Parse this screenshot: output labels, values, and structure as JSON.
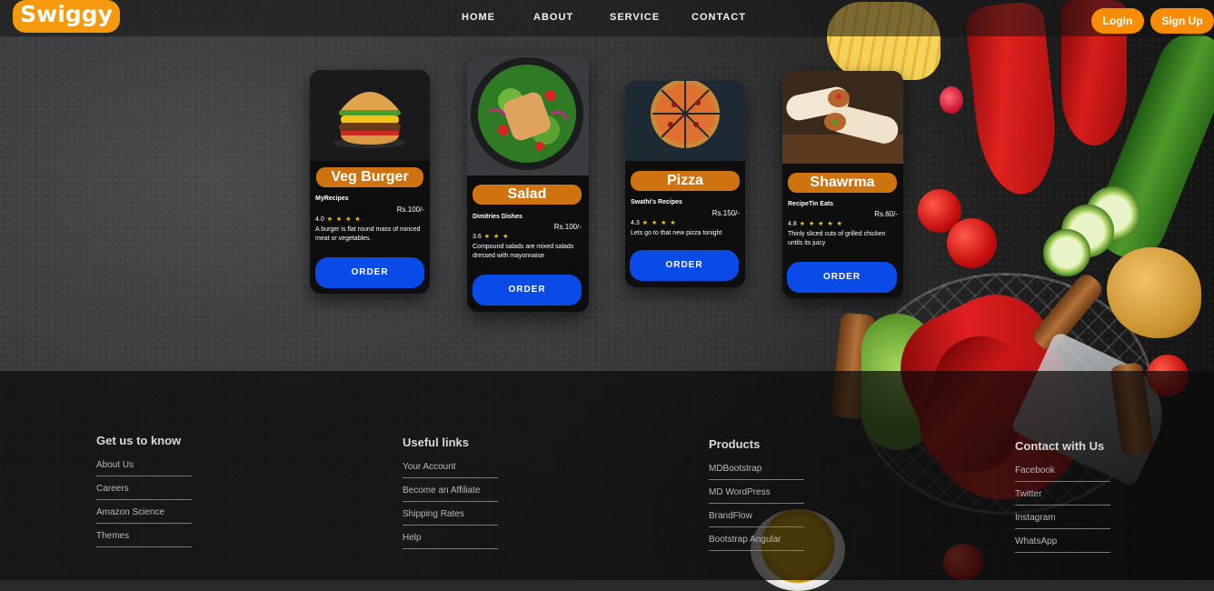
{
  "brand": {
    "name": "Swiggy",
    "color": "#f59a0c"
  },
  "nav": {
    "links": [
      "HOME",
      "ABOUT",
      "SERVICE",
      "CONTACT"
    ]
  },
  "auth": {
    "login": "Login",
    "signup": "Sign Up"
  },
  "cards": [
    {
      "title": "Veg Burger",
      "source": "MyRecipes",
      "price": "Rs.100/-",
      "rating": "4.0",
      "stars": "★ ★ ★ ★",
      "description": "A burger is flat round mass of minced meat or vegetables.",
      "button": "ORDER",
      "image": "burger"
    },
    {
      "title": "Salad",
      "source": "Dimitries Dishes",
      "price": "Rs.100/-",
      "rating": "3.6",
      "stars": "★ ★ ★",
      "description": "Compound salads are mixed salads dressed with mayonnaise",
      "button": "ORDER",
      "image": "salad"
    },
    {
      "title": "Pizza",
      "source": "Swathi's Recipes",
      "price": "Rs.150/-",
      "rating": "4.3",
      "stars": "★ ★ ★ ★",
      "description": "Lets go to that new pizza tonight",
      "button": "ORDER",
      "image": "pizza"
    },
    {
      "title": "Shawrma",
      "source": "RecipeTin Eats",
      "price": "Rs.60/-",
      "rating": "4.8",
      "stars": "★ ★ ★ ★ ★",
      "description": "Thinly sliced cuts of grilled chicken untils its juicy",
      "button": "ORDER",
      "image": "shawarma"
    }
  ],
  "footer": {
    "columns": [
      {
        "heading": "Get us to know",
        "links": [
          "About Us",
          "Careers",
          "Amazon Science",
          "Themes"
        ]
      },
      {
        "heading": "Useful links",
        "links": [
          "Your Account",
          "Become an Affiliate",
          "Shipping Rates",
          "Help"
        ]
      },
      {
        "heading": "Products",
        "links": [
          "MDBootstrap",
          "MD WordPress",
          "BrandFlow",
          "Bootstrap Angular"
        ]
      },
      {
        "heading": "Contact with Us",
        "links": [
          "Facebook",
          "Twitter",
          "Instagram",
          "WhatsApp"
        ]
      }
    ]
  },
  "colors": {
    "accent_orange": "#f88d05",
    "title_orange": "#cf7310",
    "order_blue": "#0a4be8",
    "star_yellow": "#f8c518"
  }
}
